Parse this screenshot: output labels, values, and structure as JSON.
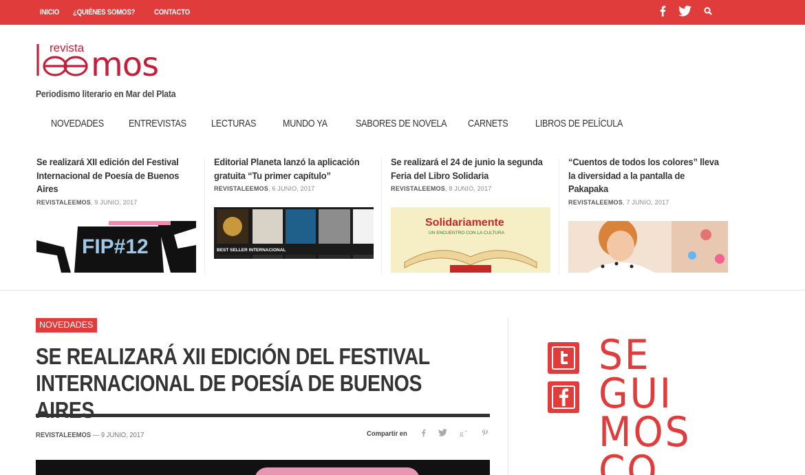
{
  "topbar": {
    "nav": [
      "INICIO",
      "¿QUIÉNES SOMOS?",
      "CONTACTO"
    ],
    "icons": [
      "facebook-icon",
      "twitter-icon",
      "search-icon"
    ]
  },
  "brand": {
    "logo_small": "revista",
    "logo_main": "leemos",
    "tagline": "Periodismo literario en Mar del Plata"
  },
  "mainnav": [
    "NOVEDADES",
    "ENTREVISTAS",
    "LECTURAS",
    "MUNDO YA",
    "SABORES DE NOVELA",
    "CARNETS",
    "LIBROS DE PELÍCULA"
  ],
  "featured": [
    {
      "title": "Se realizará XII edición del Festival Internacional de Poesía de Buenos Aires",
      "author": "REVISTALEEMOS",
      "date": "9 JUNIO, 2017",
      "image_text": "FIP#12"
    },
    {
      "title": "Editorial Planeta lanzó la aplicación gratuita “Tu primer capítulo”",
      "author": "REVISTALEEMOS",
      "date": "6 JUNIO, 2017",
      "image_text": "BEST SELLER INTERNACIONAL"
    },
    {
      "title": "Se realizará el 24 de junio la segunda Feria del Libro Solidaria",
      "author": "REVISTALEEMOS",
      "date": "8 JUNIO, 2017",
      "image_text": "Solidariamente",
      "image_sub": "UN ENCUENTRO CON LA CULTURA"
    },
    {
      "title": "“Cuentos de todos los colores” lleva la diversidad a la pantalla de Pakapaka",
      "author": "REVISTALEEMOS",
      "date": "7 JUNIO, 2017",
      "image_text": ""
    }
  ],
  "article": {
    "category": "NOVEDADES",
    "title": "SE REALIZARÁ XII EDICIÓN DEL FESTIVAL INTERNACIONAL DE POESÍA DE BUENOS AIRES",
    "author": "REVISTALEEMOS",
    "date": "9 JUNIO, 2017",
    "share_label": "Compartir en",
    "share_icons": [
      "facebook-icon",
      "twitter-icon",
      "google-plus-icon",
      "pinterest-icon"
    ]
  },
  "sidebar": {
    "social_icons": [
      "twitter-icon",
      "facebook-icon"
    ],
    "follow_text": "SE\nGUI\nMOS\nCO"
  },
  "colors": {
    "accent": "#e03c3c",
    "text": "#333333"
  }
}
